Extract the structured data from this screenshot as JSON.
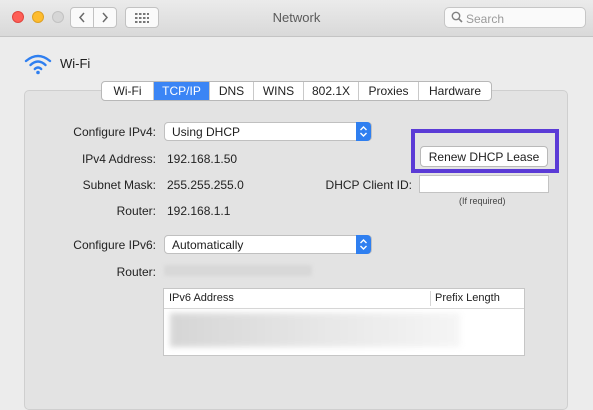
{
  "window": {
    "title": "Network"
  },
  "search": {
    "placeholder": "Search"
  },
  "interface": {
    "name": "Wi-Fi"
  },
  "tabs": [
    {
      "label": "Wi-Fi"
    },
    {
      "label": "TCP/IP",
      "active": true
    },
    {
      "label": "DNS"
    },
    {
      "label": "WINS"
    },
    {
      "label": "802.1X"
    },
    {
      "label": "Proxies"
    },
    {
      "label": "Hardware"
    }
  ],
  "ipv4": {
    "configure_label": "Configure IPv4:",
    "configure_value": "Using DHCP",
    "address_label": "IPv4 Address:",
    "address_value": "192.168.1.50",
    "subnet_label": "Subnet Mask:",
    "subnet_value": "255.255.255.0",
    "router_label": "Router:",
    "router_value": "192.168.1.1"
  },
  "dhcp": {
    "renew_label": "Renew DHCP Lease",
    "client_id_label": "DHCP Client ID:",
    "client_id_value": "",
    "client_id_hint": "(If required)"
  },
  "ipv6": {
    "configure_label": "Configure IPv6:",
    "configure_value": "Automatically",
    "router_label": "Router:",
    "table_headers": [
      "IPv6 Address",
      "Prefix Length"
    ]
  },
  "colors": {
    "accent": "#3b85f5",
    "highlight": "#5b3bd6"
  }
}
